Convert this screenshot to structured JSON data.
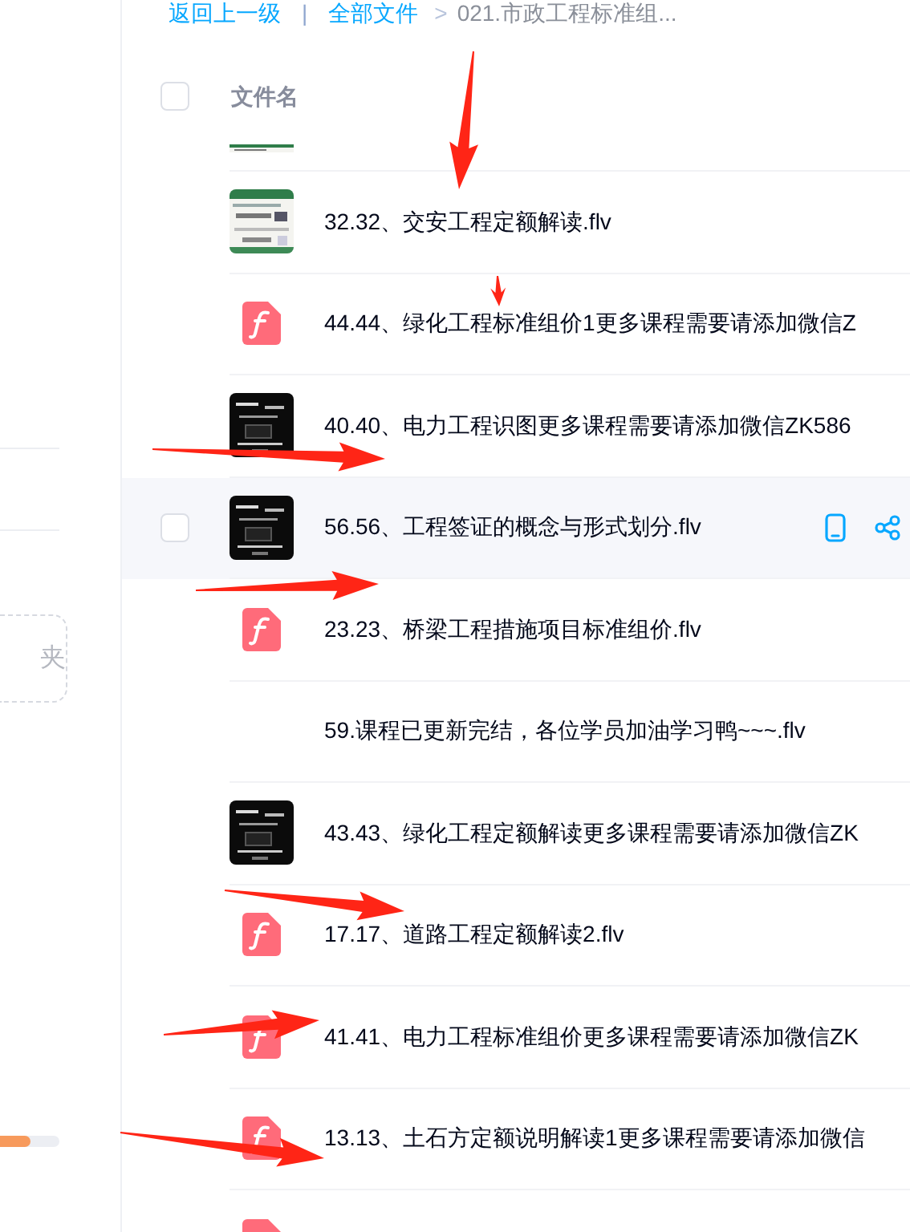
{
  "sidebar": {
    "folder_button": {
      "label": "夹"
    },
    "storage": {
      "level": 0.52
    }
  },
  "breadcrumb": {
    "back": "返回上一级",
    "separator": "|",
    "root": "全部文件",
    "arrow": ">",
    "current": "021.市政工程标准组..."
  },
  "table": {
    "header": {
      "checked": false,
      "label": "文件名"
    },
    "rows": [
      {
        "kind": "picture",
        "name": "32.32、交安工程定额解读.flv",
        "hovered": false,
        "checked": false
      },
      {
        "kind": "flash",
        "name": "44.44、绿化工程标准组价1更多课程需要请添加微信Z",
        "hovered": false,
        "checked": false
      },
      {
        "kind": "picture",
        "name": "40.40、电力工程识图更多课程需要请添加微信ZK586",
        "hovered": false,
        "checked": false
      },
      {
        "kind": "picture",
        "name": "56.56、工程签证的概念与形式划分.flv",
        "hovered": true,
        "checked": false
      },
      {
        "kind": "flash",
        "name": "23.23、桥梁工程措施项目标准组价.flv",
        "hovered": false,
        "checked": false
      },
      {
        "kind": "none",
        "name": "59.课程已更新完结，各位学员加油学习鸭~~~.flv",
        "hovered": false,
        "checked": false
      },
      {
        "kind": "picture",
        "name": "43.43、绿化工程定额解读更多课程需要请添加微信ZK",
        "hovered": false,
        "checked": false
      },
      {
        "kind": "flash",
        "name": "17.17、道路工程定额解读2.flv",
        "hovered": false,
        "checked": false
      },
      {
        "kind": "flash",
        "name": "41.41、电力工程标准组价更多课程需要请添加微信ZK",
        "hovered": false,
        "checked": false
      },
      {
        "kind": "flash",
        "name": "13.13、土石方定额说明解读1更多课程需要请添加微信",
        "hovered": false,
        "checked": false
      }
    ]
  }
}
